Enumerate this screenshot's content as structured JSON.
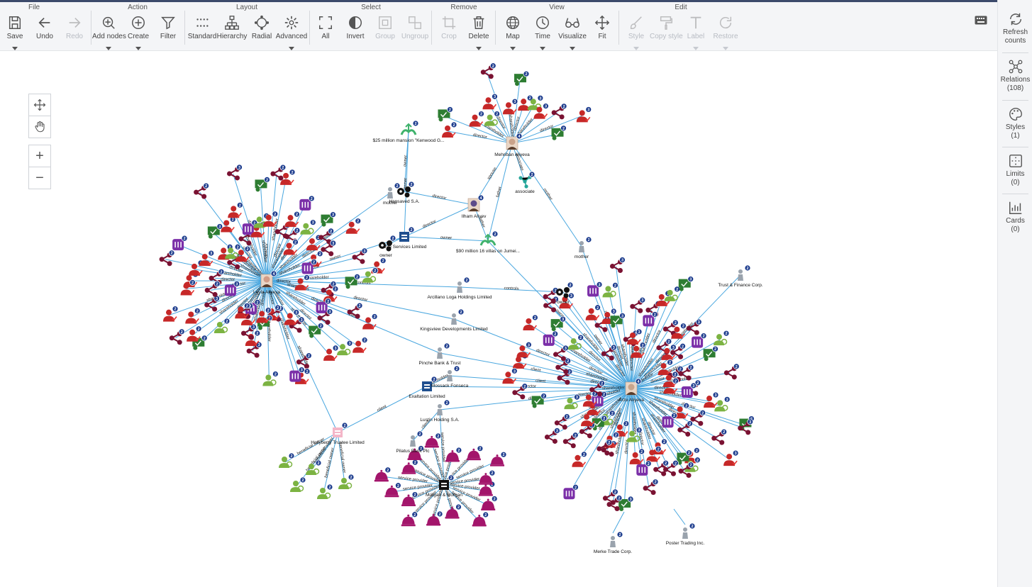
{
  "toolbar": {
    "groups": {
      "file": "File",
      "action": "Action",
      "layout": "Layout",
      "select": "Select",
      "remove": "Remove",
      "view": "View",
      "edit": "Edit"
    },
    "buttons": {
      "save": "Save",
      "undo": "Undo",
      "redo": "Redo",
      "add_nodes": "Add nodes",
      "create": "Create",
      "filter": "Filter",
      "standard": "Standard",
      "hierarchy": "Hierarchy",
      "radial": "Radial",
      "advanced": "Advanced",
      "all": "All",
      "invert": "Invert",
      "group": "Group",
      "ungroup": "Ungroup",
      "crop": "Crop",
      "delete": "Delete",
      "map": "Map",
      "time": "Time",
      "visualize": "Visualize",
      "fit": "Fit",
      "style": "Style",
      "copy_style": "Copy style",
      "label": "Label",
      "restore": "Restore"
    }
  },
  "sidebar": {
    "refresh": {
      "line1": "Refresh",
      "line2": "counts"
    },
    "relations": {
      "label": "Relations",
      "count": "(108)"
    },
    "styles": {
      "label": "Styles",
      "count": "(1)"
    },
    "limits": {
      "label": "Limits",
      "count": "(0)"
    },
    "cards": {
      "label": "Cards",
      "count": "(0)"
    }
  },
  "colors": {
    "edge": "#4aa7df",
    "person_red": "#c62828",
    "share_maroon": "#7a1232",
    "client_purple": "#7b2fa8",
    "service_magenta": "#a3156b",
    "green": "#2e7d32",
    "light_green": "#7cb342",
    "badge": "#1a3a8c"
  },
  "graph": {
    "hub_nodes": [
      {
        "id": "mehriban",
        "label": "Mehriban Aliyeva"
      },
      {
        "id": "leyla",
        "label": "Leyla Aliyeva"
      },
      {
        "id": "arzu",
        "label": "Arzu Aliyeva"
      },
      {
        "id": "ilham",
        "label": "Ilham Aliyev"
      }
    ],
    "entity_nodes": [
      {
        "id": "mansion",
        "label": "$25 million mansion \"Kenwood G..."
      },
      {
        "id": "villas",
        "label": "$90 million 16 villas on Jumei..."
      },
      {
        "id": "serv",
        "label": "Ante Services Limited"
      },
      {
        "id": "arcillano",
        "label": "Arcillano Loga Holdings Limited"
      },
      {
        "id": "kingsview",
        "label": "Kingsview Developments Limited"
      },
      {
        "id": "exaltation",
        "label": "Exaltation Limited"
      },
      {
        "id": "lustin",
        "label": "Lustin Holding S.A."
      },
      {
        "id": "pilatus",
        "label": "Pilatus Bank Plc"
      },
      {
        "id": "hollyberry",
        "label": "Hollyberry Trustee Limited"
      },
      {
        "id": "morgan",
        "label": "Morgan & Morgan"
      },
      {
        "id": "mossack",
        "label": "Mossack Fonseca"
      },
      {
        "id": "pinche",
        "label": "Pinche Bank & Trust"
      },
      {
        "id": "finance",
        "label": "Trust & Finance Corp."
      },
      {
        "id": "merke",
        "label": "Merke Trade Corp."
      },
      {
        "id": "poster",
        "label": "Poster Trading Inc."
      },
      {
        "id": "hansaved",
        "label": "Hansaved S.A."
      },
      {
        "id": "associate1",
        "label": "associate"
      },
      {
        "id": "mother1",
        "label": "mother"
      },
      {
        "id": "mother2",
        "label": "mother"
      },
      {
        "id": "owner1",
        "label": "owner"
      },
      {
        "id": "owner2",
        "label": "owner"
      }
    ],
    "edge_labels": [
      "director",
      "shareholder",
      "owner",
      "controls",
      "client",
      "service provider",
      "beneficial owner",
      "representative",
      "father",
      "manager",
      "associate",
      "spouse",
      "facilitator",
      "founder"
    ]
  }
}
